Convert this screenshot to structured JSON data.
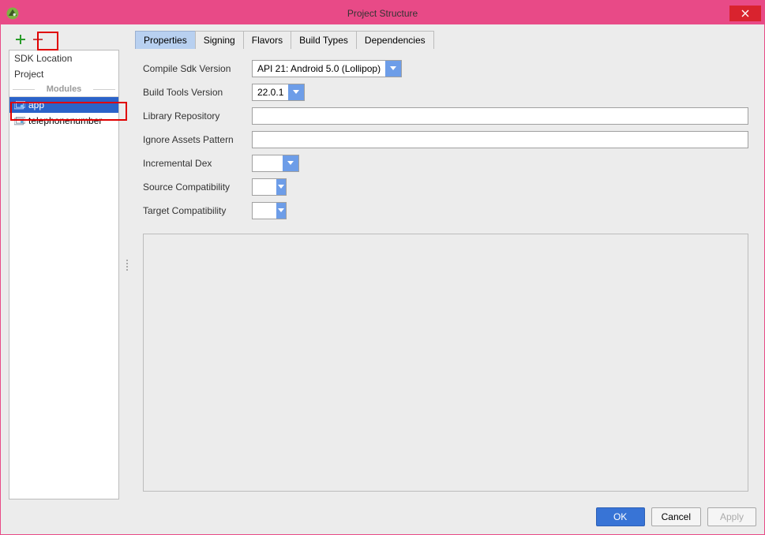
{
  "window": {
    "title": "Project Structure"
  },
  "toolbar": {
    "add_tooltip": "Add",
    "remove_tooltip": "Remove"
  },
  "sidebar": {
    "items": [
      {
        "label": "SDK Location"
      },
      {
        "label": "Project"
      }
    ],
    "section_label": "Modules",
    "modules": [
      {
        "label": "app",
        "selected": true
      },
      {
        "label": "telephonenumber",
        "selected": false
      }
    ]
  },
  "tabs": [
    {
      "label": "Properties",
      "active": true
    },
    {
      "label": "Signing",
      "active": false
    },
    {
      "label": "Flavors",
      "active": false
    },
    {
      "label": "Build Types",
      "active": false
    },
    {
      "label": "Dependencies",
      "active": false
    }
  ],
  "properties": {
    "compile_sdk": {
      "label": "Compile Sdk Version",
      "value": "API 21: Android 5.0 (Lollipop)"
    },
    "build_tools": {
      "label": "Build Tools Version",
      "value": "22.0.1"
    },
    "library_repo": {
      "label": "Library Repository",
      "value": ""
    },
    "ignore_assets": {
      "label": "Ignore Assets Pattern",
      "value": ""
    },
    "incremental_dex": {
      "label": "Incremental Dex",
      "value": ""
    },
    "source_compat": {
      "label": "Source Compatibility",
      "value": ""
    },
    "target_compat": {
      "label": "Target Compatibility",
      "value": ""
    }
  },
  "buttons": {
    "ok": "OK",
    "cancel": "Cancel",
    "apply": "Apply"
  },
  "colors": {
    "accent": "#e84a87",
    "selection": "#2b63c9",
    "combo_btn": "#6d9de8",
    "primary_btn": "#3874d6"
  }
}
